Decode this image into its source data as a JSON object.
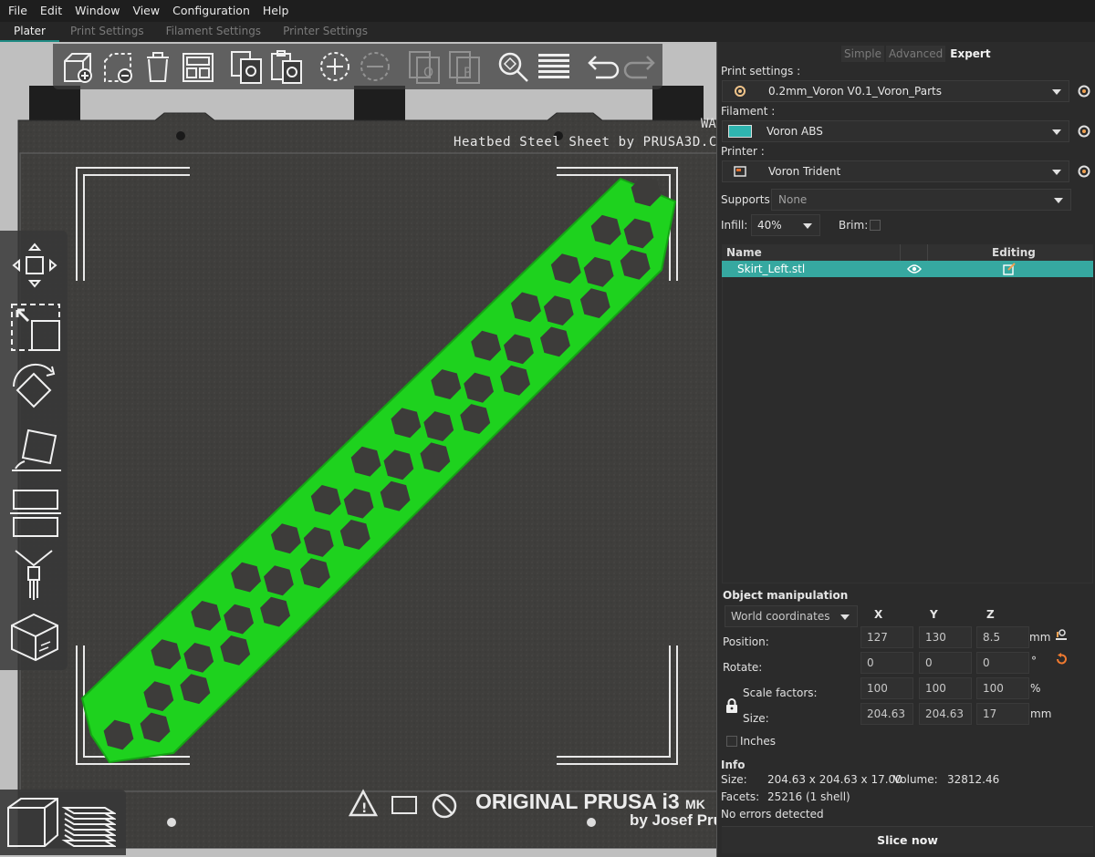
{
  "menu": [
    "File",
    "Edit",
    "Window",
    "View",
    "Configuration",
    "Help"
  ],
  "tabs": [
    "Plater",
    "Print Settings",
    "Filament Settings",
    "Printer Settings"
  ],
  "bed": {
    "title": "Heatbed Steel Sheet by PRUSA3D.C",
    "corner_text": "WA",
    "brand": "ORIGINAL PRUSA i3",
    "brand_suffix": "MK",
    "byline": "by Josef Pru"
  },
  "modes": [
    "Simple",
    "Advanced",
    "Expert"
  ],
  "print_settings": {
    "label": "Print settings :",
    "value": "0.2mm_Voron V0.1_Voron_Parts"
  },
  "filament": {
    "label": "Filament :",
    "value": "Voron ABS",
    "color": "#2fb5b0"
  },
  "printer": {
    "label": "Printer :",
    "value": "Voron Trident"
  },
  "supports": {
    "label": "Supports:",
    "value": "None"
  },
  "infill": {
    "label": "Infill:",
    "value": "40%"
  },
  "brim": {
    "label": "Brim:"
  },
  "object_list": {
    "headers": {
      "name": "Name",
      "editing": "Editing"
    },
    "rows": [
      {
        "name": "Skirt_Left.stl"
      }
    ]
  },
  "manipulation": {
    "title": "Object manipulation",
    "coord_system": "World coordinates",
    "axes": [
      "X",
      "Y",
      "Z"
    ],
    "position": {
      "label": "Position:",
      "values": [
        "127",
        "130",
        "8.5"
      ],
      "unit": "mm"
    },
    "rotate": {
      "label": "Rotate:",
      "values": [
        "0",
        "0",
        "0"
      ],
      "unit": "°"
    },
    "scale": {
      "label": "Scale factors:",
      "values": [
        "100",
        "100",
        "100"
      ],
      "unit": "%"
    },
    "size": {
      "label": "Size:",
      "values": [
        "204.63",
        "204.63",
        "17"
      ],
      "unit": "mm"
    },
    "inches_label": "Inches"
  },
  "info": {
    "title": "Info",
    "size_label": "Size:",
    "size_value": "204.63 x 204.63 x 17.00",
    "volume_label": "Volume:",
    "volume_value": "32812.46",
    "facets_label": "Facets:",
    "facets_value": "25216 (1 shell)",
    "errors": "No errors detected"
  },
  "slice_button": "Slice now",
  "colors": {
    "accent": "#36a8a0",
    "model": "#1ed21e",
    "bed": "#3d3c3a"
  }
}
